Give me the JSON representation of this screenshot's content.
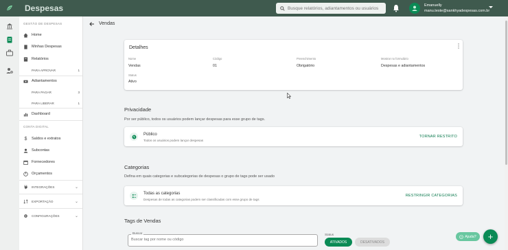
{
  "header": {
    "app_title": "Despesas",
    "search_placeholder": "Busque relatórios, adiantamentos ou usuários",
    "user_name": "Emanuelly",
    "user_email": "manu.teste@sankhyadespesas.com.br"
  },
  "sidebar": {
    "section_expenses": "GESTÃO DE DESPESAS",
    "home": "Home",
    "my_expenses": "Minhas Despesas",
    "reports": "Relatórios",
    "to_approve": "PARA APROVAR",
    "to_approve_count": "1",
    "advances": "Adiantamentos",
    "to_pay": "PARA PAGAR",
    "to_pay_count": "3",
    "to_release": "PARA LIBERAR",
    "to_release_count": "1",
    "dashboard": "Dashboard",
    "section_digital": "CONTA DIGITAL",
    "balances": "Saldos e extratos",
    "subaccounts": "Subcontas",
    "suppliers": "Fornecedores",
    "budgets": "Orçamentos",
    "integrations": "INTEGRAÇÕES",
    "export": "EXPORTAÇÃO",
    "settings": "CONFIGURAÇÕES"
  },
  "main": {
    "page_title": "Vendas",
    "details": {
      "title": "Detalhes",
      "name_label": "Nome",
      "name_value": "Vendas",
      "code_label": "Código",
      "code_value": "01",
      "fill_label": "Preenchimento",
      "fill_value": "Obrigatório",
      "show_label": "Mostrar no formulário",
      "show_value": "Despesas e adiantamentos",
      "status_label": "Status",
      "status_value": "Ativo"
    },
    "privacy": {
      "title": "Privacidade",
      "description": "Por ser público, todos os usuários podem lançar despesas para esse grupo de tags.",
      "row_title": "Público",
      "row_sub": "Todos os usuários podem lançar despesas",
      "action": "TORNAR RESTRITO"
    },
    "categories": {
      "title": "Categorias",
      "description": "Defina em quais categorias e subcategorias de despesas o grupo de tags pode ser usado",
      "row_title": "Todas as categorias",
      "row_sub": "Despesas de todas as categorias podem ser classificadas com esse grupo de tags",
      "action": "RESTRINGIR CATEGORIAS"
    },
    "tags": {
      "title": "Tags de Vendas",
      "search_label": "Buscar",
      "search_placeholder": "Buscar tag por nome ou código",
      "status_label": "Status",
      "active_btn": "ATIVADOS",
      "inactive_btn": "DESATIVADOS"
    }
  },
  "help_label": "Ajuda?",
  "fab_label": "+",
  "colors": {
    "brand": "#0a8a55",
    "header": "#3f5a4e"
  }
}
